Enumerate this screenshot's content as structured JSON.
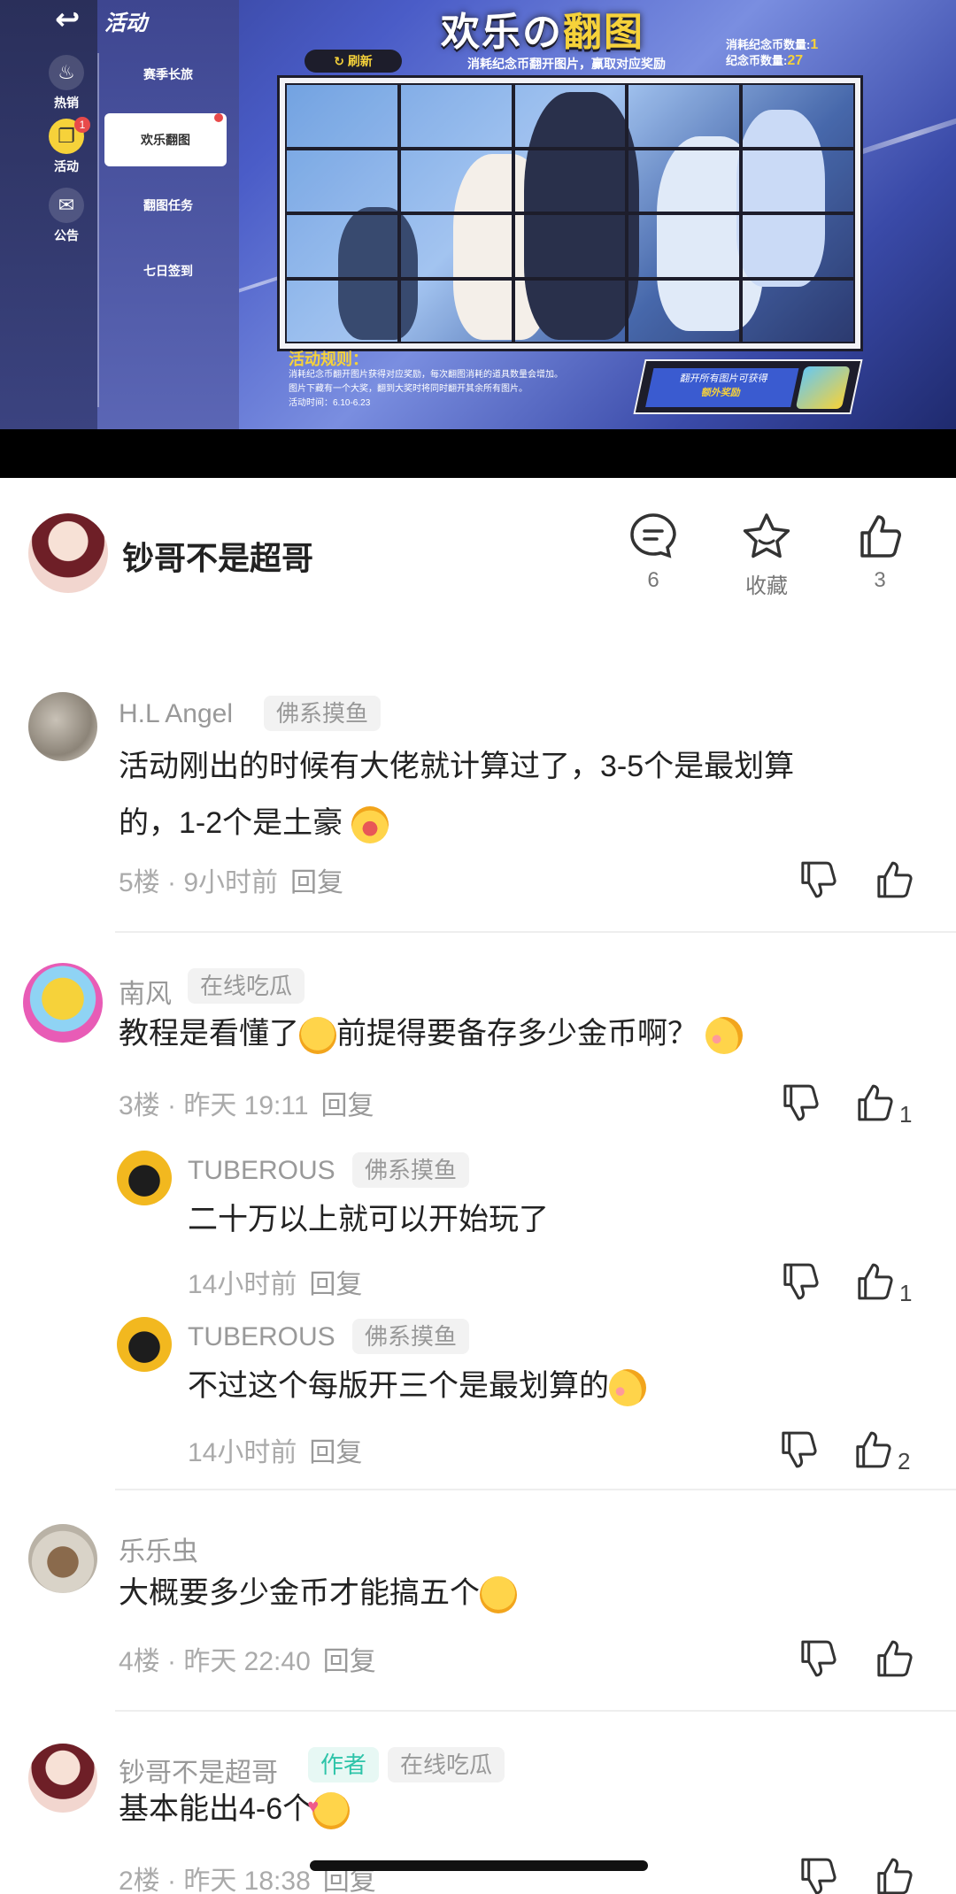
{
  "game": {
    "back_icon": "back-arrow-icon",
    "title": "活动",
    "side_tabs": [
      {
        "label": "热销",
        "icon": "flame-icon"
      },
      {
        "label": "活动",
        "icon": "gift-icon",
        "badge": "1"
      },
      {
        "label": "公告",
        "icon": "notice-icon"
      }
    ],
    "menu_items": [
      "赛季长旅",
      "欢乐翻图",
      "翻图任务",
      "七日签到"
    ],
    "refresh_label": "刷新",
    "banner_text_a": "欢乐の",
    "banner_text_b": "翻图",
    "subtitle": "消耗纪念币翻开图片，赢取对应奖励",
    "coin_consumed_label": "消耗纪念币数量:",
    "coin_consumed_value": "1",
    "coin_count_label": "纪念币数量:",
    "coin_count_value": "27",
    "rules_title": "活动规则：",
    "rules_line1": "消耗纪念币翻开图片获得对应奖励，每次翻图消耗的道具数量会增加。",
    "rules_line2": "图片下藏有一个大奖，翻到大奖时将同时翻开其余所有图片。",
    "rules_line3": "活动时间：6.10-6.23",
    "reward_line1": "翻开所有图片可获得",
    "reward_line2": "额外奖励"
  },
  "post": {
    "author_name": "钞哥不是超哥",
    "comment_count": "6",
    "favorite_label": "收藏",
    "like_count": "3"
  },
  "comments": [
    {
      "name": "H.L Angel",
      "tag": "佛系摸鱼",
      "text_a": "活动刚出的时候有大佬就计算过了，3-5个是最划算",
      "text_b": "的，1-2个是土豪",
      "floor": "5楼 · 9小时前",
      "reply": "回复"
    },
    {
      "name": "南风",
      "tag": "在线吃瓜",
      "text_a": "教程是看懂了",
      "text_b": "前提得要备存多少金币啊？",
      "floor": "3楼 · 昨天 19:11",
      "reply": "回复",
      "likes": "1"
    },
    {
      "name": "TUBEROUS",
      "tag": "佛系摸鱼",
      "text": "二十万以上就可以开始玩了",
      "floor": "14小时前",
      "reply": "回复",
      "likes": "1"
    },
    {
      "name": "TUBEROUS",
      "tag": "佛系摸鱼",
      "text": "不过这个每版开三个是最划算的",
      "floor": "14小时前",
      "reply": "回复",
      "likes": "2"
    },
    {
      "name": "乐乐虫",
      "text": "大概要多少金币才能搞五个",
      "floor": "4楼 · 昨天 22:40",
      "reply": "回复"
    },
    {
      "name": "钞哥不是超哥",
      "author_tag": "作者",
      "tag": "在线吃瓜",
      "text": "基本能出4-6个",
      "floor": "2楼 · 昨天 18:38",
      "reply": "回复"
    }
  ]
}
